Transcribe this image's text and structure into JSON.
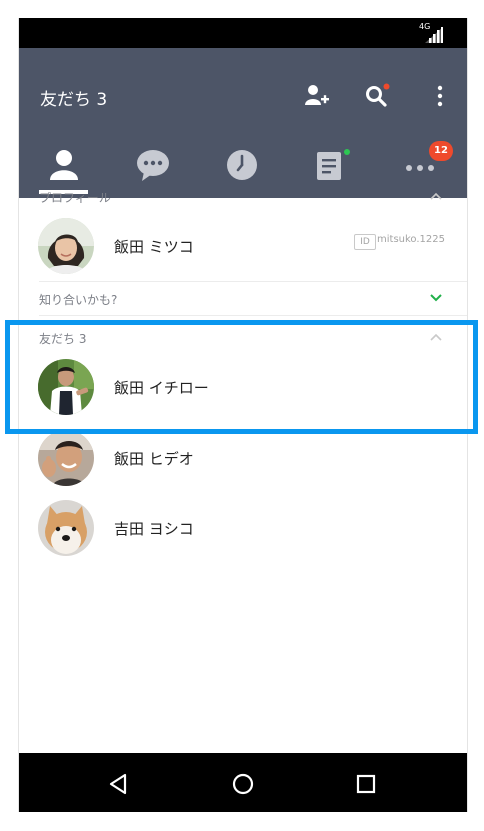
{
  "status_bar": {
    "network": "4G"
  },
  "header": {
    "title": "友だち 3",
    "icons": [
      "add-friend-icon",
      "search-icon",
      "more-vertical-icon"
    ]
  },
  "tabs": [
    {
      "name": "friends",
      "icon": "person-icon",
      "active": true
    },
    {
      "name": "chats",
      "icon": "chat-bubble-icon"
    },
    {
      "name": "timeline",
      "icon": "clock-icon"
    },
    {
      "name": "news",
      "icon": "document-icon"
    },
    {
      "name": "more",
      "icon": "more-dots-icon",
      "badge": "12"
    }
  ],
  "profile_section": {
    "label": "プロフィール",
    "name": "飯田 ミツコ",
    "id_chip": "ID",
    "id_value": "mitsuko.1225"
  },
  "suggestion_section": {
    "label": "知り合いかも?"
  },
  "friends_section": {
    "label": "友だち 3",
    "friends": [
      {
        "name": "飯田 イチロー"
      },
      {
        "name": "飯田 ヒデオ"
      },
      {
        "name": "吉田 ヨシコ"
      }
    ]
  },
  "colors": {
    "header": "#4d5567",
    "highlight": "#0a97ef",
    "badge": "#ef4a2c",
    "dot_red": "#ef4a2c",
    "dot_green": "#2dc653",
    "chevron_green": "#21b04a"
  }
}
